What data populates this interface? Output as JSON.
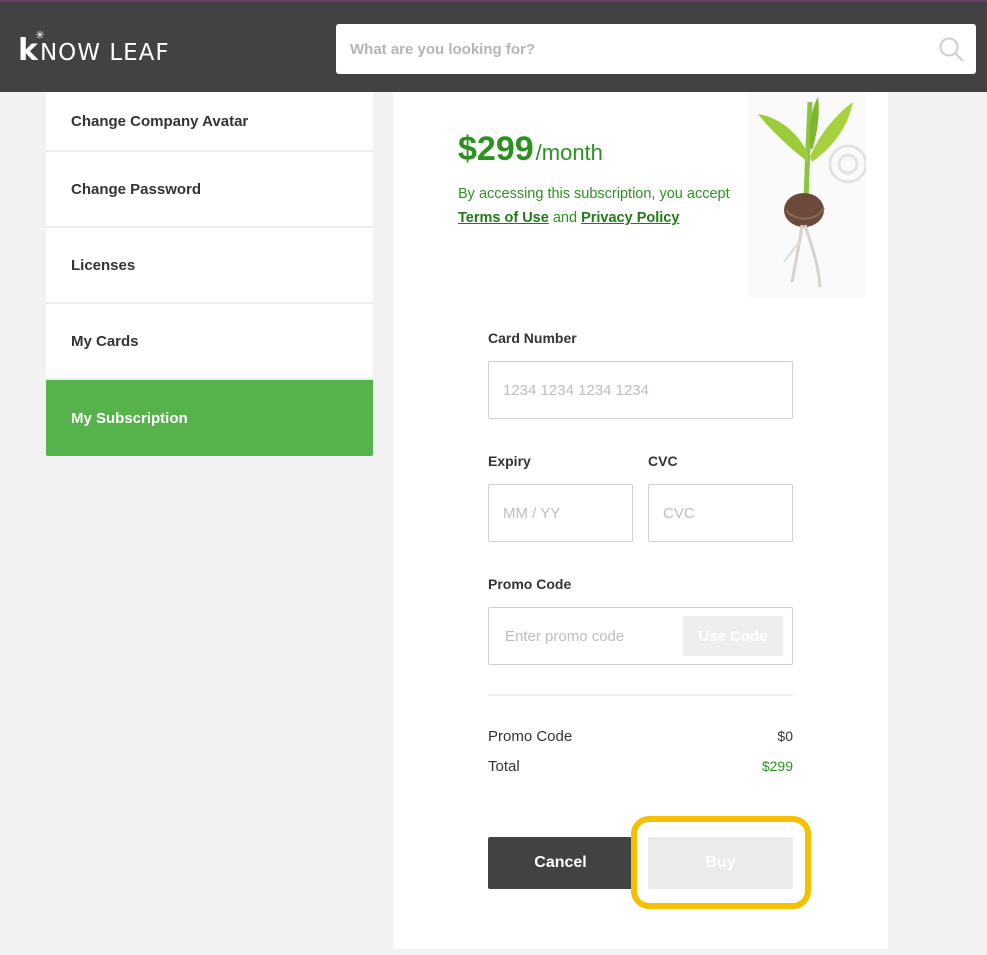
{
  "header": {
    "logo_letter": "k",
    "logo_text": "NOW LEAF",
    "search_placeholder": "What are you looking for?"
  },
  "sidebar": {
    "items": [
      {
        "label": "Change Company Avatar",
        "active": false
      },
      {
        "label": "Change Password",
        "active": false
      },
      {
        "label": "Licenses",
        "active": false
      },
      {
        "label": "My Cards",
        "active": false
      },
      {
        "label": "My Subscription",
        "active": true
      }
    ]
  },
  "subscription": {
    "price": "$299",
    "period": "/month",
    "terms_prefix": "By accessing this subscription, you accept",
    "terms_link": "Terms of Use",
    "terms_and": "and",
    "privacy_link": "Privacy Policy"
  },
  "form": {
    "card_number_label": "Card Number",
    "card_number_placeholder": "1234 1234 1234 1234",
    "expiry_label": "Expiry",
    "expiry_placeholder": "MM / YY",
    "cvc_label": "CVC",
    "cvc_placeholder": "CVC",
    "promo_label": "Promo Code",
    "promo_placeholder": "Enter promo code",
    "use_code_label": "Use Code"
  },
  "summary": {
    "promo_label": "Promo Code",
    "promo_value": "$0",
    "total_label": "Total",
    "total_value": "$299"
  },
  "actions": {
    "cancel_label": "Cancel",
    "buy_label": "Buy"
  },
  "colors": {
    "accent_green": "#56b34b",
    "price_green": "#2c9121",
    "header_bg": "#424242",
    "highlight": "#f5c000"
  }
}
